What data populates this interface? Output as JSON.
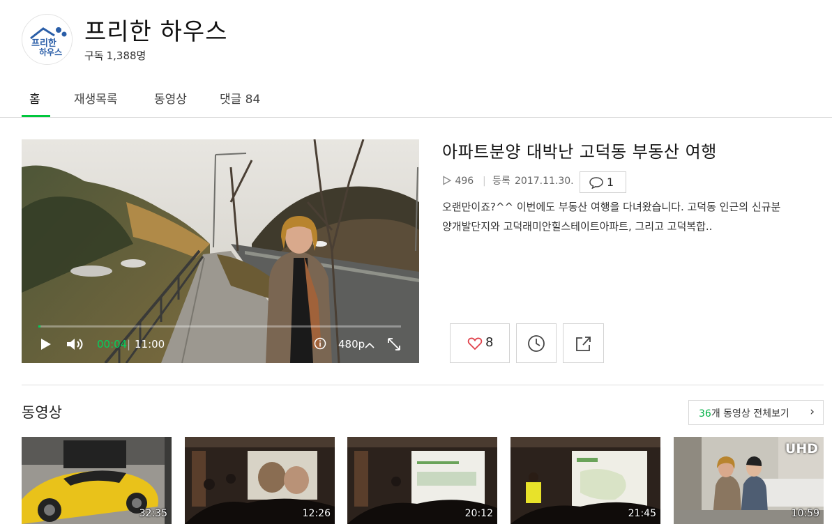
{
  "channel": {
    "name": "프리한 하우스",
    "subscribe_label": "구독",
    "subscriber_count": "1,388명",
    "logo_text": "프리한 하우스"
  },
  "tabs": [
    {
      "label": "홈",
      "active": true
    },
    {
      "label": "재생목록",
      "active": false
    },
    {
      "label": "동영상",
      "active": false
    },
    {
      "label": "댓글 84",
      "active": false
    }
  ],
  "player": {
    "current_time": "00:04",
    "duration": "11:00",
    "quality": "480p",
    "progress": 0.006,
    "icons": [
      "play-icon",
      "volume-icon",
      "info-icon",
      "chevron-up-icon",
      "fullscreen-icon"
    ]
  },
  "video": {
    "title": "아파트분양 대박난 고덕동 부동산 여행",
    "views": "496",
    "registered_label": "등록",
    "date": "2017.11.30.",
    "comments": "1",
    "description": "오랜만이죠?^^ 이번에도 부동산 여행을 다녀왔습니다. 고덕동 인근의 신규분양개발단지와 고덕래미안힐스테이트아파트, 그리고 고덕복합..",
    "likes": "8"
  },
  "videos_section": {
    "title": "동영상",
    "count": "36",
    "see_all_text": "개 동영상 전체보기",
    "thumbnails": [
      {
        "duration": "32:35",
        "badge": ""
      },
      {
        "duration": "12:26",
        "badge": ""
      },
      {
        "duration": "20:12",
        "badge": ""
      },
      {
        "duration": "21:45",
        "badge": ""
      },
      {
        "duration": "10:59",
        "badge": "UHD"
      }
    ]
  },
  "colors": {
    "accent_green": "#00c73c",
    "time_green": "#00d25f",
    "like_red": "#e0404a"
  }
}
